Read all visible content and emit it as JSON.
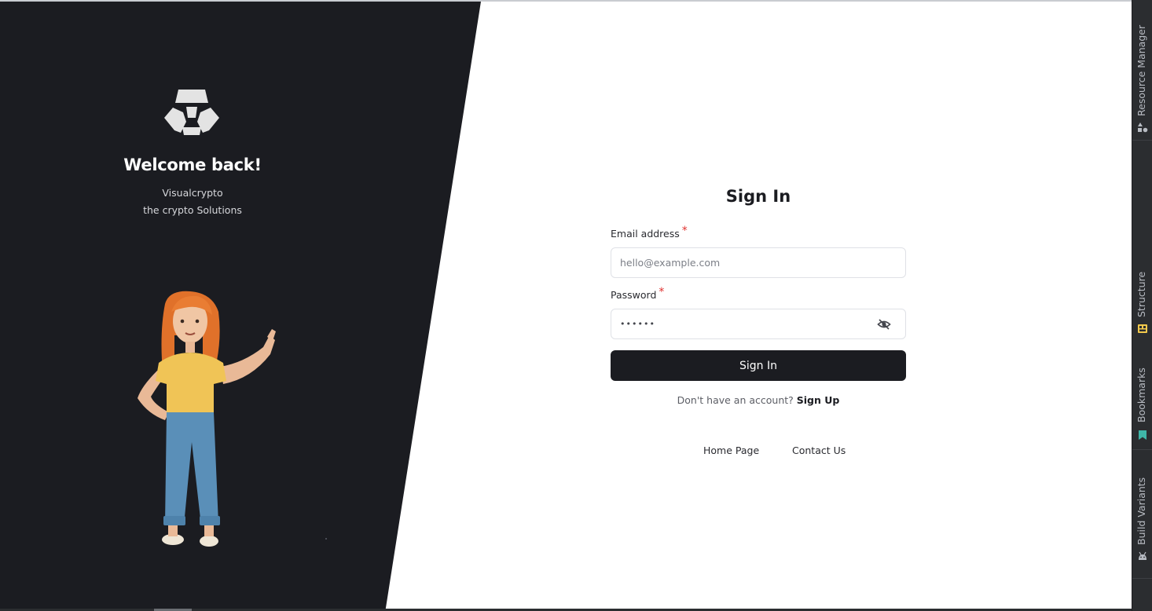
{
  "brand": {
    "welcome": "Welcome back!",
    "tagline_line1": "Visualcrypto",
    "tagline_line2": "the crypto Solutions"
  },
  "form": {
    "title": "Sign In",
    "email_label": "Email address",
    "email_placeholder": "hello@example.com",
    "password_label": "Password",
    "password_value": "••••••",
    "required_mark": "*",
    "submit_label": "Sign In",
    "no_account_text": "Don't have an account?",
    "signup_link": "Sign Up"
  },
  "footer_links": {
    "home": "Home Page",
    "contact": "Contact Us"
  },
  "ide_sidebar": {
    "tabs": [
      {
        "label": "Resource Manager",
        "icon": "resource-manager-icon"
      },
      {
        "label": "Structure",
        "icon": "structure-icon"
      },
      {
        "label": "Bookmarks",
        "icon": "bookmark-icon"
      },
      {
        "label": "Build Variants",
        "icon": "android-icon"
      }
    ]
  },
  "colors": {
    "panel_dark": "#1b1c21",
    "required": "#e0312f",
    "structure_icon": "#f2c94c",
    "bookmark_icon": "#3fb6a8"
  }
}
